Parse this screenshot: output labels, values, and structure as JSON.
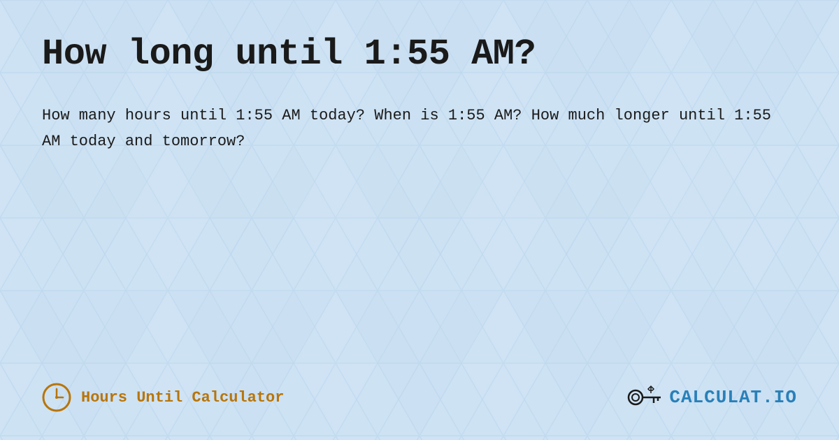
{
  "page": {
    "title": "How long until 1:55 AM?",
    "description": "How many hours until 1:55 AM today? When is 1:55 AM? How much longer until 1:55 AM today and tomorrow?",
    "background_color": "#d6e8f7"
  },
  "footer": {
    "brand_label": "Hours Until Calculator",
    "logo_text": "CALCULAT.IO",
    "logo_text_colored": "IO"
  }
}
